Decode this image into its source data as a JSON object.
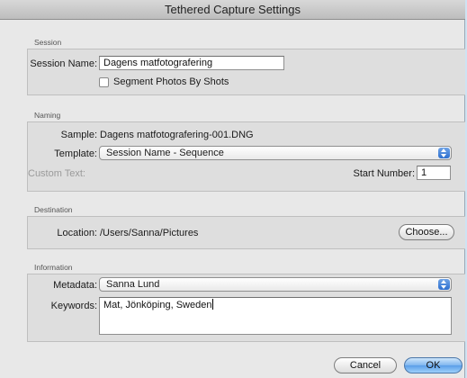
{
  "window": {
    "title": "Tethered Capture Settings"
  },
  "session": {
    "group_label": "Session",
    "name_label": "Session Name:",
    "name_value": "Dagens matfotografering",
    "segment_label": "Segment Photos By Shots",
    "segment_checked": false
  },
  "naming": {
    "group_label": "Naming",
    "sample_label": "Sample:",
    "sample_value": "Dagens matfotografering-001.DNG",
    "template_label": "Template:",
    "template_value": "Session Name - Sequence",
    "custom_text_label": "Custom Text:",
    "start_number_label": "Start Number:",
    "start_number_value": "1"
  },
  "destination": {
    "group_label": "Destination",
    "location_label": "Location:",
    "location_value": "/Users/Sanna/Pictures",
    "choose_label": "Choose..."
  },
  "information": {
    "group_label": "Information",
    "metadata_label": "Metadata:",
    "metadata_value": "Sanna Lund",
    "keywords_label": "Keywords:",
    "keywords_value": "Mat, Jönköping, Sweden"
  },
  "buttons": {
    "cancel_label": "Cancel",
    "ok_label": "OK"
  },
  "colors": {
    "accent": "#5a9ee8",
    "window_bg": "#e8e8e8",
    "group_bg": "#dedede"
  }
}
